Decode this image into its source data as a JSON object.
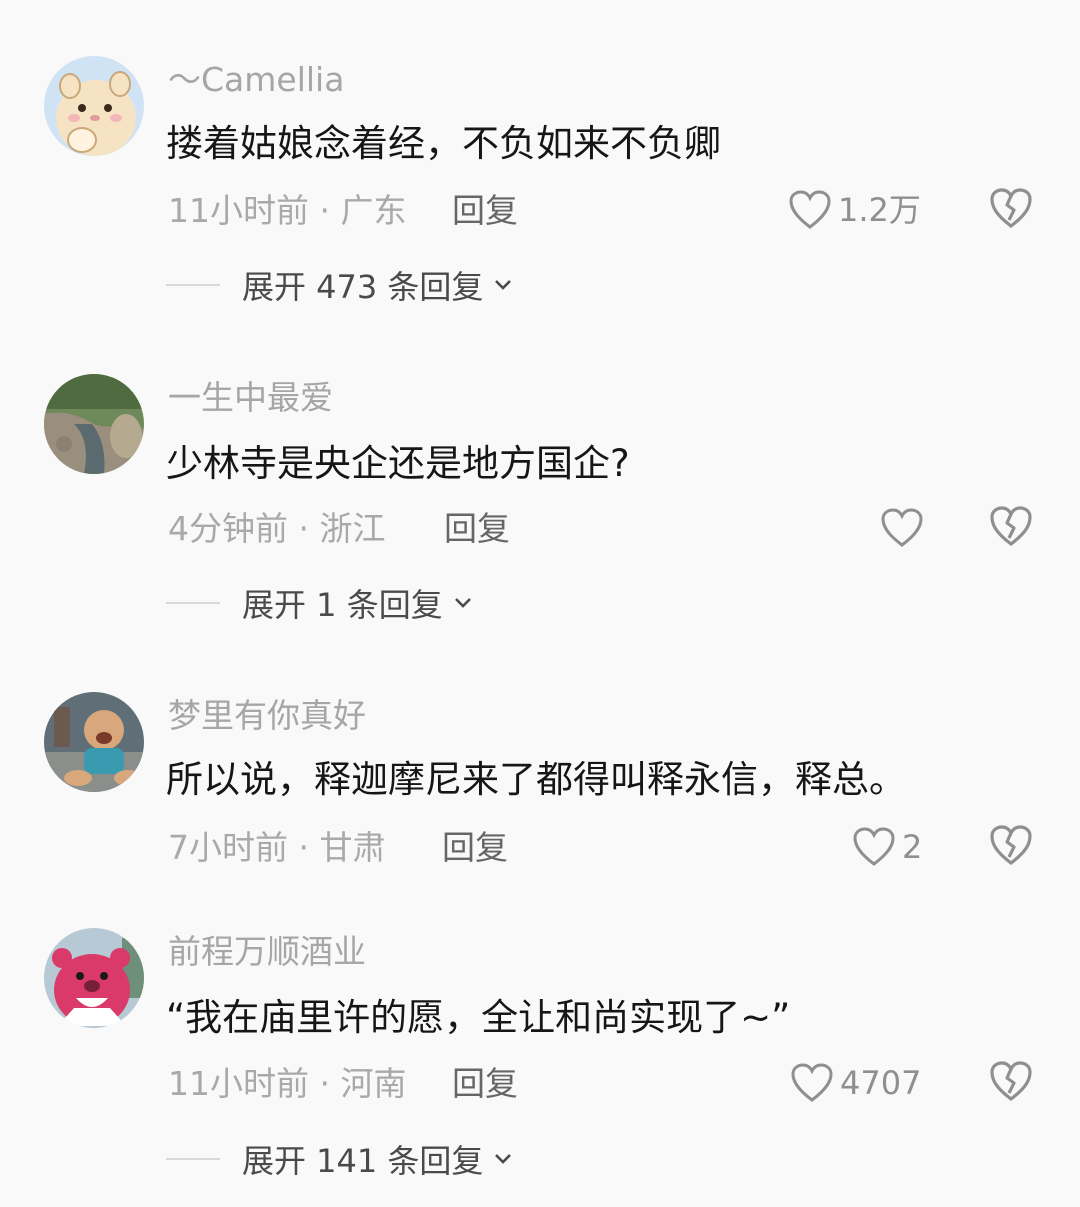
{
  "comments": [
    {
      "username": "～Camellia",
      "text": "搂着姑娘念着经，不负如来不负卿",
      "time": "11小时前",
      "location": "广东",
      "meta": "11小时前 · 广东",
      "reply_label": "回复",
      "likes": "1.2万",
      "expand_label": "展开 473 条回复",
      "avatar_icon": "cartoon-hamster-avatar-icon",
      "avatar_colors": [
        "#cfe3f5",
        "#f6e3c4"
      ]
    },
    {
      "username": "一生中最爱",
      "text": "少林寺是央企还是地方国企?",
      "time": "4分钟前",
      "location": "浙江",
      "meta": "4分钟前 · 浙江",
      "reply_label": "回复",
      "likes": "",
      "expand_label": "展开 1 条回复",
      "avatar_icon": "stream-photo-avatar-icon",
      "avatar_colors": [
        "#6e8a5a",
        "#9a8f7e"
      ]
    },
    {
      "username": "梦里有你真好",
      "text": "所以说，释迦摩尼来了都得叫释永信，释总。",
      "time": "7小时前",
      "location": "甘肃",
      "meta": "7小时前 · 甘肃",
      "reply_label": "回复",
      "likes": "2",
      "expand_label": "",
      "avatar_icon": "child-photo-avatar-icon",
      "avatar_colors": [
        "#5f6e77",
        "#d8a77b"
      ]
    },
    {
      "username": "前程万顺酒业",
      "text": "“我在庙里许的愿，全让和尚实现了~”",
      "time": "11小时前",
      "location": "河南",
      "meta": "11小时前 · 河南",
      "reply_label": "回复",
      "likes": "4707",
      "expand_label": "展开 141 条回复",
      "avatar_icon": "pink-bear-avatar-icon",
      "avatar_colors": [
        "#d93a6a",
        "#b7c9d4"
      ]
    }
  ],
  "icons": {
    "like": "heart-outline-icon",
    "dislike": "broken-heart-icon",
    "expand": "chevron-down-icon"
  },
  "colors": {
    "background": "#f9f9f9",
    "username": "#a6a6a6",
    "text": "#161616",
    "meta": "#a9a9a9",
    "icon": "#8f8f8f"
  }
}
